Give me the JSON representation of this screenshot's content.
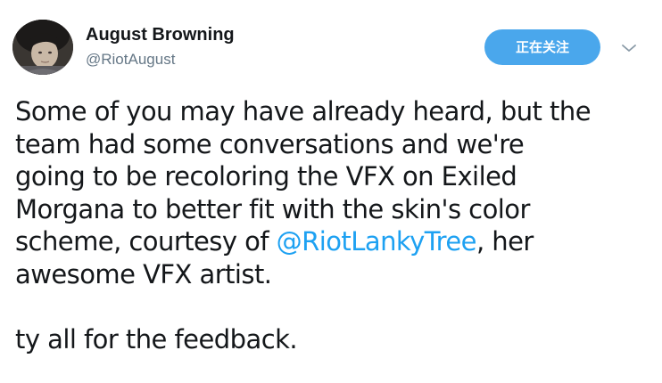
{
  "author": {
    "display_name": "August Browning",
    "handle": "@RiotAugust",
    "avatar_icon": "profile-photo-icon"
  },
  "header": {
    "follow_button_label": "正在关注",
    "menu_icon": "chevron-down-icon"
  },
  "tweet": {
    "line1": "Some of you may have already heard, but the",
    "line2": "team had some conversations and we're",
    "line3": "going to be recoloring the VFX on Exiled",
    "line4": "Morgana to better fit with the skin's color",
    "line5_before": "scheme, courtesy of ",
    "mention": "@RiotLankyTree",
    "line5_after": ", her",
    "line6": "awesome VFX artist.",
    "line7": "ty all for the feedback."
  },
  "colors": {
    "follow_button": "#4aa7ec",
    "mention": "#1da1f2",
    "handle": "#657786",
    "text": "#14171a"
  }
}
